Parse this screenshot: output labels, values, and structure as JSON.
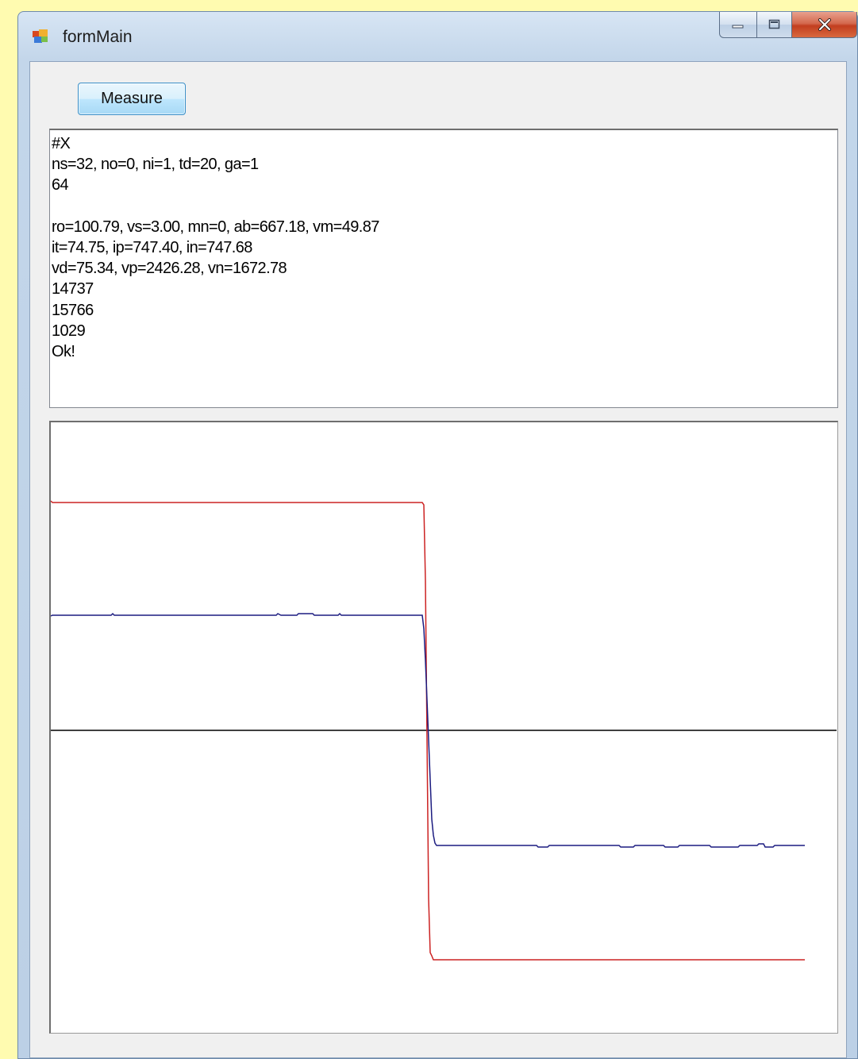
{
  "window": {
    "title": "formMain"
  },
  "toolbar": {
    "measure_label": "Measure"
  },
  "output": {
    "lines": [
      "#X",
      "ns=32, no=0, ni=1, td=20, ga=1",
      "64",
      "",
      "ro=100.79, vs=3.00, mn=0, ab=667.18, vm=49.87",
      "it=74.75, ip=747.40, in=747.68",
      "vd=75.34, vp=2426.28, vn=1672.78",
      "14737",
      "15766",
      "1029",
      "Ok!"
    ]
  },
  "colors": {
    "red_trace": "#cc2222",
    "blue_trace": "#1c1c80",
    "axis": "#000000"
  }
}
